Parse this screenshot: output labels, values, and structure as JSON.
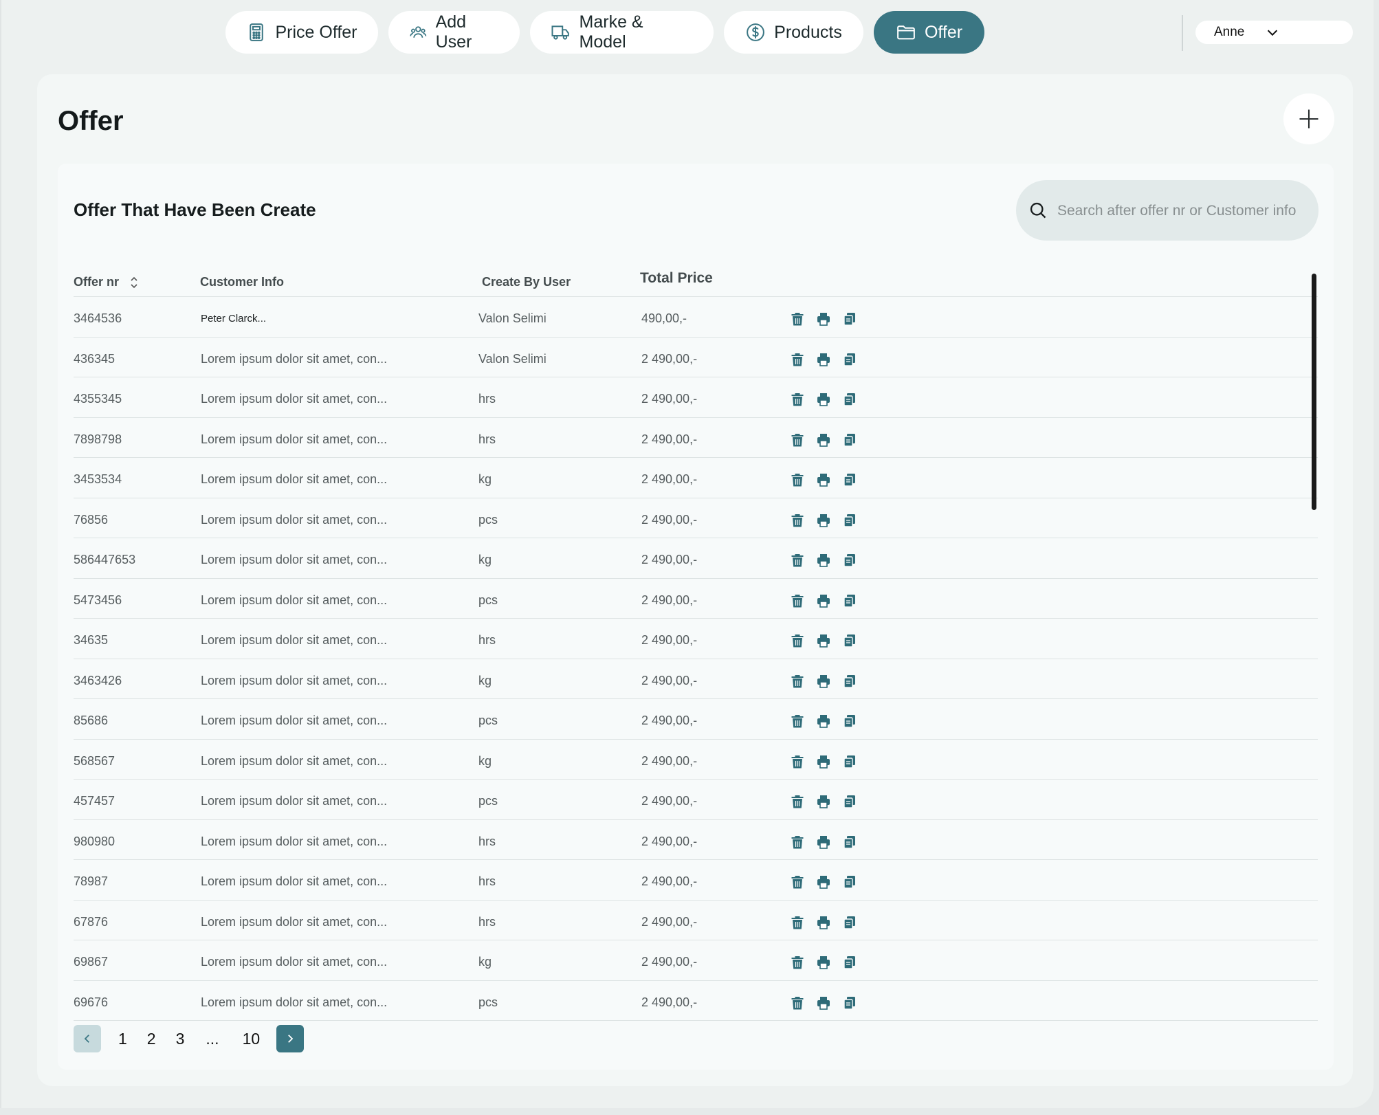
{
  "nav": {
    "items": [
      {
        "label": "Price Offer",
        "icon": "calculator-icon"
      },
      {
        "label": "Add User",
        "icon": "users-icon"
      },
      {
        "label": "Marke & Model",
        "icon": "truck-icon"
      },
      {
        "label": "Products",
        "icon": "dollar-circle-icon"
      },
      {
        "label": "Offer",
        "icon": "folder-icon"
      }
    ],
    "active": "Offer",
    "user": "Anne"
  },
  "colors": {
    "accent": "#3a7683",
    "background": "#edf1f0",
    "panel": "#f7fafa"
  },
  "page": {
    "title": "Offer"
  },
  "panel": {
    "title": "Offer That Have Been Create",
    "search_placeholder": "Search after offer nr or Customer info"
  },
  "table": {
    "headers": {
      "offer_nr": "Offer nr",
      "customer": "Customer Info",
      "created_by": "Create By User",
      "total": "Total Price"
    },
    "rows": [
      {
        "nr": "3464536",
        "customer": "Peter Clarck...",
        "user": "Valon Selimi",
        "price": "490,00,-"
      },
      {
        "nr": "436345",
        "customer": "Lorem ipsum dolor sit amet, con...",
        "user": "Valon Selimi",
        "price": "2 490,00,-"
      },
      {
        "nr": "4355345",
        "customer": "Lorem ipsum dolor sit amet, con...",
        "user": "hrs",
        "price": "2 490,00,-"
      },
      {
        "nr": "7898798",
        "customer": "Lorem ipsum dolor sit amet, con...",
        "user": "hrs",
        "price": "2 490,00,-"
      },
      {
        "nr": "3453534",
        "customer": "Lorem ipsum dolor sit amet, con...",
        "user": "kg",
        "price": "2 490,00,-"
      },
      {
        "nr": "76856",
        "customer": "Lorem ipsum dolor sit amet, con...",
        "user": "pcs",
        "price": "2 490,00,-"
      },
      {
        "nr": "586447653",
        "customer": "Lorem ipsum dolor sit amet, con...",
        "user": "kg",
        "price": "2 490,00,-"
      },
      {
        "nr": "5473456",
        "customer": "Lorem ipsum dolor sit amet, con...",
        "user": "pcs",
        "price": "2 490,00,-"
      },
      {
        "nr": "34635",
        "customer": "Lorem ipsum dolor sit amet, con...",
        "user": "hrs",
        "price": "2 490,00,-"
      },
      {
        "nr": "3463426",
        "customer": "Lorem ipsum dolor sit amet, con...",
        "user": "kg",
        "price": "2 490,00,-"
      },
      {
        "nr": "85686",
        "customer": "Lorem ipsum dolor sit amet, con...",
        "user": "pcs",
        "price": "2 490,00,-"
      },
      {
        "nr": "568567",
        "customer": "Lorem ipsum dolor sit amet, con...",
        "user": "kg",
        "price": "2 490,00,-"
      },
      {
        "nr": "457457",
        "customer": "Lorem ipsum dolor sit amet, con...",
        "user": "pcs",
        "price": "2 490,00,-"
      },
      {
        "nr": "980980",
        "customer": "Lorem ipsum dolor sit amet, con...",
        "user": "hrs",
        "price": "2 490,00,-"
      },
      {
        "nr": "78987",
        "customer": "Lorem ipsum dolor sit amet, con...",
        "user": "hrs",
        "price": "2 490,00,-"
      },
      {
        "nr": "67876",
        "customer": "Lorem ipsum dolor sit amet, con...",
        "user": "hrs",
        "price": "2 490,00,-"
      },
      {
        "nr": "69867",
        "customer": "Lorem ipsum dolor sit amet, con...",
        "user": "kg",
        "price": "2 490,00,-"
      },
      {
        "nr": "69676",
        "customer": "Lorem ipsum dolor sit amet, con...",
        "user": "pcs",
        "price": "2 490,00,-"
      }
    ],
    "row_actions": [
      "trash-icon",
      "printer-icon",
      "copy-icon"
    ]
  },
  "pagination": {
    "pages": [
      "1",
      "2",
      "3",
      "...",
      "10"
    ]
  }
}
